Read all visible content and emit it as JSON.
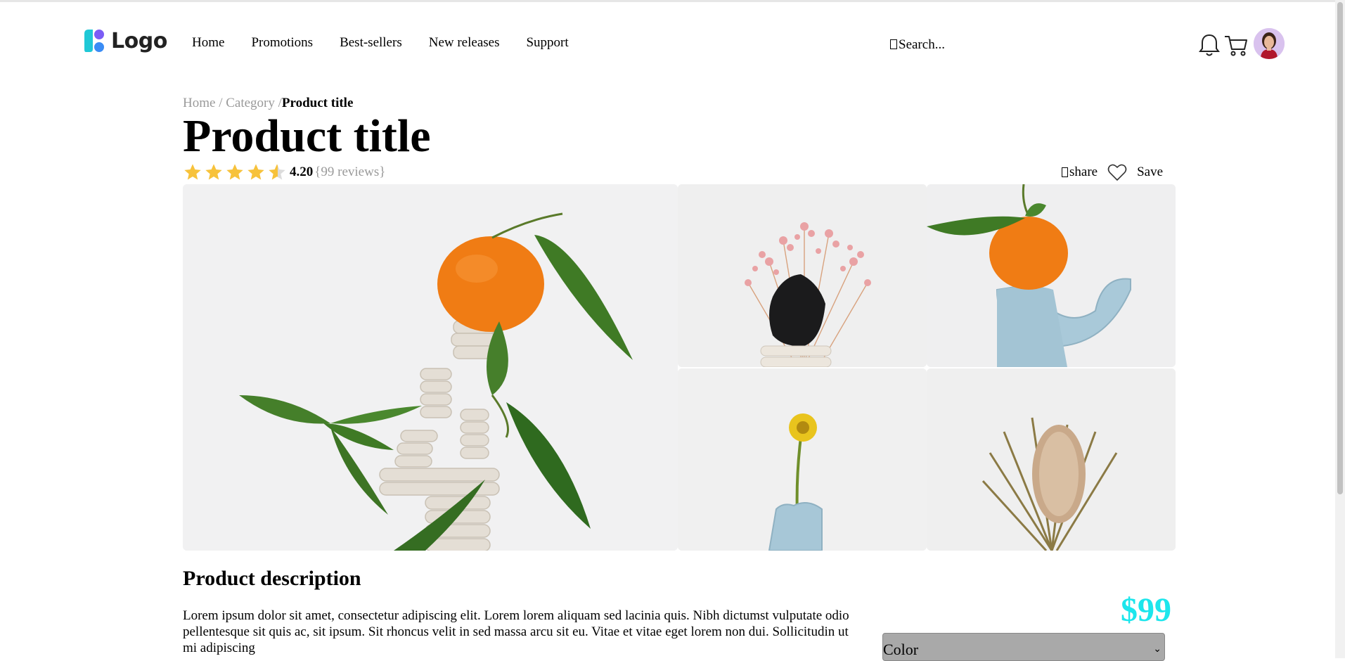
{
  "header": {
    "logo_text": "Logo",
    "nav": [
      "Home",
      "Promotions",
      "Best-sellers",
      "New releases",
      "Support"
    ],
    "search_placeholder": "Search...",
    "icons": {
      "notifications": "bell-icon",
      "cart": "cart-icon",
      "search": "search-icon"
    }
  },
  "breadcrumb": {
    "items": [
      "Home",
      "Category"
    ],
    "separator": "/",
    "current": "Product title"
  },
  "product": {
    "title": "Product title",
    "rating_value": "4.20",
    "review_count": "{99 reviews}",
    "stars": 4.2,
    "share_label": "share",
    "save_label": "Save"
  },
  "gallery": {
    "images": [
      "orange-stacked-clay-vase",
      "pink-dried-flowers-black-rock",
      "orange-on-blue-clay-sculpture",
      "yellow-flower-blue-vase",
      "dried-banksia-bouquet"
    ]
  },
  "description": {
    "heading": "Product description",
    "text": "Lorem ipsum dolor sit amet, consectetur adipiscing elit. Lorem lorem aliquam sed lacinia quis. Nibh dictumst vulputate odio pellentesque sit quis ac, sit ipsum. Sit rhoncus velit in sed massa arcu sit eu. Vitae et vitae eget lorem non dui. Sollicitudin ut mi adipiscing"
  },
  "purchase": {
    "price": "$99",
    "color_label": "Color"
  },
  "colors": {
    "star": "#f7c23b",
    "price": "#1ce6ec",
    "muted_text": "#9a9a9a",
    "select_bg": "#a9a9a9"
  }
}
